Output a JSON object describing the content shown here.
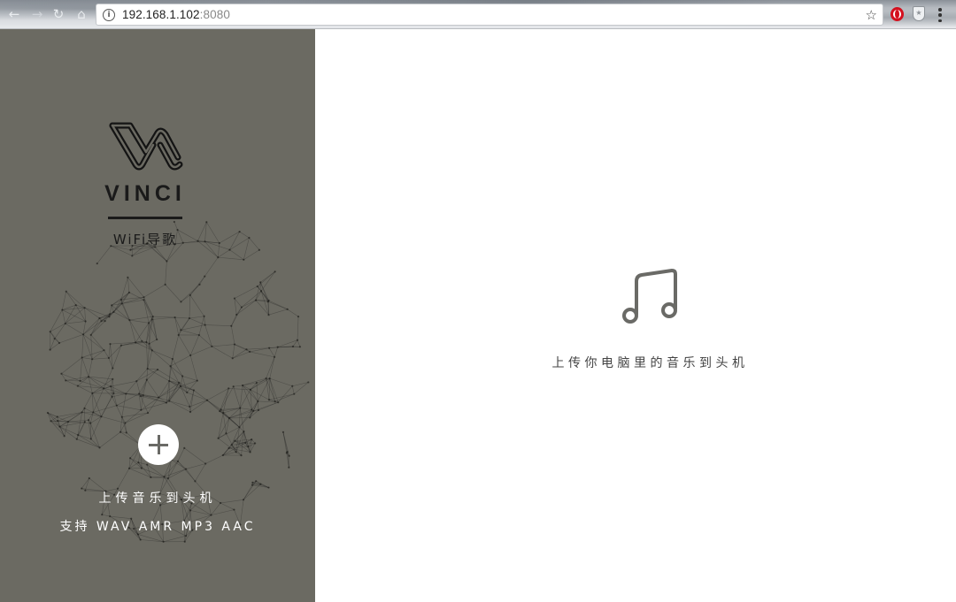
{
  "browser": {
    "url_host": "192.168.1.102",
    "url_port": ":8080",
    "back_icon": "←",
    "forward_icon": "→",
    "reload_icon": "↻",
    "home_icon": "⌂",
    "star_icon": "☆",
    "info_icon": "i",
    "shield_icon": "★"
  },
  "sidebar": {
    "brand": "VINCI",
    "subtitle": "WiFi导歌",
    "upload_label": "上传音乐到头机",
    "formats_label": "支持 WAV AMR MP3 AAC",
    "background_color": "#6b6a62"
  },
  "main": {
    "hint": "上传你电脑里的音乐到头机"
  },
  "colors": {
    "panel": "#6b6a62",
    "icon_gray": "#6a6a66",
    "opera_red": "#d4101e"
  }
}
